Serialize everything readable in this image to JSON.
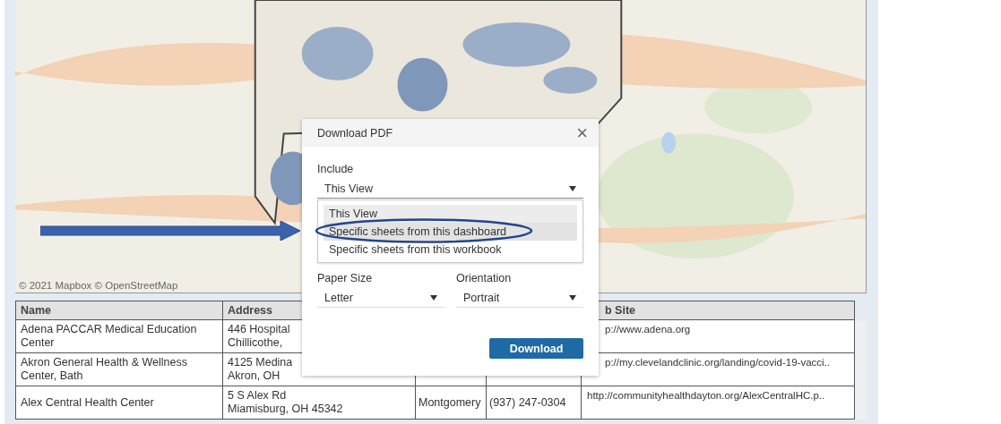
{
  "map": {
    "kind": "picture",
    "attribution": "© 2021 Mapbox © OpenStreetMap"
  },
  "table": {
    "columns": {
      "name": "Name",
      "address": "Address",
      "web_site": "b Site"
    },
    "rows": [
      {
        "name": [
          "Adena PACCAR Medical Education",
          "Center"
        ],
        "address": [
          "446 Hospital",
          "Chillicothe,"
        ],
        "web_site": "p://www.adena.org"
      },
      {
        "name": [
          "Akron General Health & Wellness",
          "Center, Bath"
        ],
        "address": [
          "4125 Medina",
          "Akron, OH"
        ],
        "web_site": "p://my.clevelandclinic.org/landing/covid-19-vacci.."
      },
      {
        "name": [
          "Alex Central Health Center"
        ],
        "address": [
          "5 S Alex Rd",
          "Miamisburg, OH 45342"
        ],
        "county": "Montgomery",
        "phone": "(937) 247-0304",
        "web_site": "http://communityhealthdayton.org/AlexCentralHC.p.."
      }
    ]
  },
  "dialog": {
    "title": "Download PDF",
    "close": "×",
    "include": {
      "label": "Include",
      "value": "This View",
      "expanded": true,
      "options": [
        {
          "label": "This View",
          "selected": true,
          "hovered": false
        },
        {
          "label": "Specific sheets from this dashboard",
          "selected": false,
          "hovered": true
        },
        {
          "label": "Specific sheets from this workbook",
          "selected": false,
          "hovered": false
        }
      ]
    },
    "paper_size": {
      "label": "Paper Size",
      "value": "Letter"
    },
    "orientation": {
      "label": "Orientation",
      "value": "Portrait"
    },
    "button": "Download"
  }
}
